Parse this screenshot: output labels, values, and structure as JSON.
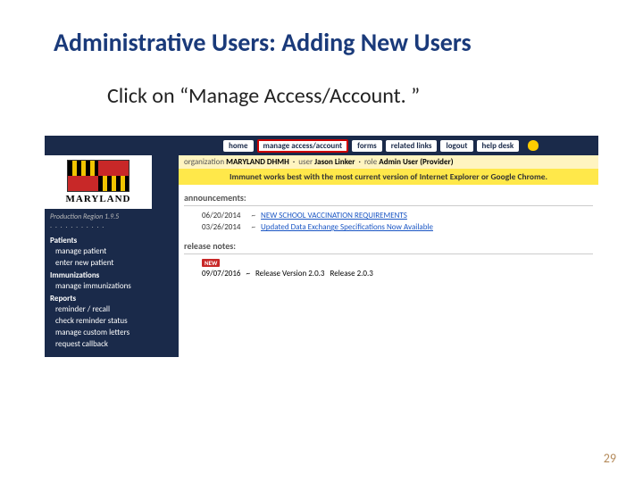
{
  "title": "Administrative Users: Adding New Users",
  "instruction": "Click on “Manage Access/Account. ”",
  "nav": {
    "home": "home",
    "manage": "manage access/account",
    "forms": "forms",
    "related": "related links",
    "logout": "logout",
    "helpdesk": "help desk"
  },
  "orgbar": {
    "org_label": "organization",
    "org_value": "MARYLAND DHMH",
    "user_label": "user",
    "user_value": "Jason Linker",
    "role_label": "role",
    "role_value": "Admin User (Provider)"
  },
  "compat_banner": "Immunet works best with the most current version of Internet Explorer or Google Chrome.",
  "sidebar": {
    "region": "Production Region 1.9.5",
    "dots": ". . . . . . . . . . . ",
    "sections": [
      {
        "header": "Patients",
        "items": [
          "manage patient",
          "enter new patient"
        ]
      },
      {
        "header": "Immunizations",
        "items": [
          "manage immunizations"
        ]
      },
      {
        "header": "Reports",
        "items": [
          "reminder / recall",
          "check reminder status",
          "manage custom letters",
          "request callback"
        ]
      }
    ]
  },
  "logo_text": "MARYLAND",
  "announcements": {
    "header": "announcements:",
    "rows": [
      {
        "date": "06/20/2014",
        "sep": "~",
        "link": "NEW SCHOOL VACCINATION REQUIREMENTS"
      },
      {
        "date": "03/26/2014",
        "sep": "~",
        "link": "Updated Data Exchange Specifications Now Available"
      }
    ]
  },
  "release": {
    "header": "release notes:",
    "new": "NEW",
    "date": "09/07/2016",
    "sep": "~",
    "link": "Release Version 2.0.3",
    "tail": "Release 2.0.3"
  },
  "page_num": "29"
}
